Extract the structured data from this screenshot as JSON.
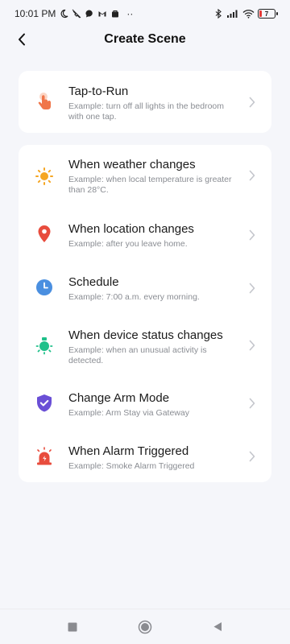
{
  "status_bar": {
    "time": "10:01 PM",
    "battery_level": "7",
    "more": "··"
  },
  "header": {
    "title": "Create Scene"
  },
  "tap_to_run": {
    "title": "Tap-to-Run",
    "description": "Example: turn off all lights in the bedroom with one tap.",
    "icon": "tap-hand-icon"
  },
  "automations": [
    {
      "title": "When weather changes",
      "description": "Example: when local temperature is greater than 28°C.",
      "icon": "sun-icon",
      "color": "#f5a623"
    },
    {
      "title": "When location changes",
      "description": "Example: after you leave home.",
      "icon": "location-pin-icon",
      "color": "#e84c3d"
    },
    {
      "title": "Schedule",
      "description": "Example: 7:00 a.m. every morning.",
      "icon": "clock-icon",
      "color": "#4a8fe0"
    },
    {
      "title": "When device status changes",
      "description": "Example: when an unusual activity is detected.",
      "icon": "device-status-icon",
      "color": "#1fc08a"
    },
    {
      "title": "Change Arm Mode",
      "description": "Example: Arm Stay via Gateway",
      "icon": "shield-check-icon",
      "color": "#6a4fd6"
    },
    {
      "title": "When Alarm Triggered",
      "description": "Example: Smoke Alarm Triggered",
      "icon": "alarm-siren-icon",
      "color": "#e84c3d"
    }
  ],
  "colors": {
    "background": "#f5f6fa",
    "card": "#ffffff",
    "tap_icon": "#f0764a"
  }
}
